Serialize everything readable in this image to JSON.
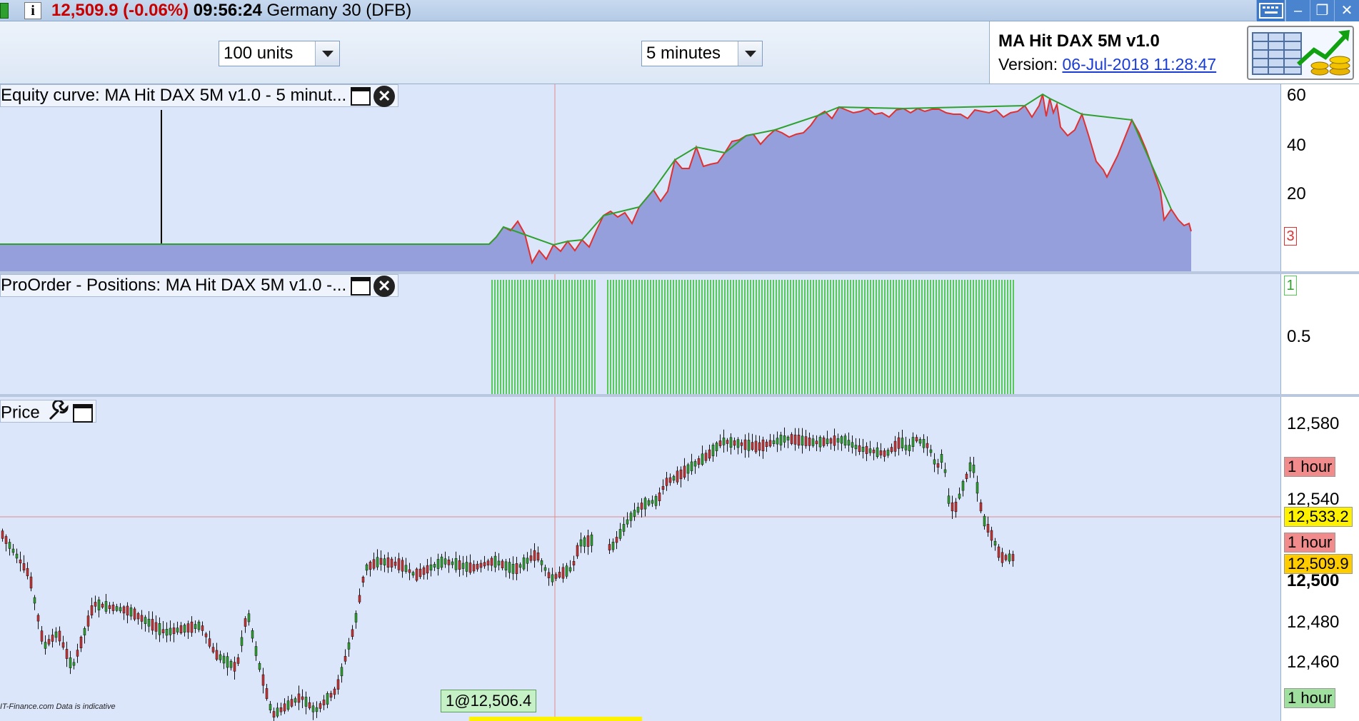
{
  "titlebar": {
    "price": "12,509.9 (-0.06%)",
    "time": "09:56:24",
    "instrument": "Germany 30 (DFB)"
  },
  "toolbar": {
    "units": "100 units",
    "timeframe": "5 minutes"
  },
  "info": {
    "system_name": "MA Hit DAX 5M v1.0",
    "version_label": "Version:",
    "version_date": "06-Jul-2018 11:28:47"
  },
  "equity_panel": {
    "label": "Equity curve: MA Hit DAX 5M v1.0 - 5 minut...",
    "ticks": [
      "60",
      "40",
      "20"
    ],
    "marker": "3"
  },
  "positions_panel": {
    "label": "ProOrder - Positions: MA Hit DAX 5M v1.0 -...",
    "ticks": [
      "0.5"
    ],
    "marker": "1"
  },
  "price_panel": {
    "label": "Price",
    "ticks": [
      "12,580",
      "12,540",
      "12,500",
      "12,480",
      "12,460"
    ],
    "tag_hour_1": "1 hour",
    "tag_crosshair": "12,533.2",
    "tag_hour_2": "1 hour",
    "tag_last": "12,509.9",
    "tag_hour_3": "1 hour",
    "order_label": "1@12,506.4",
    "source": "IT-Finance.com",
    "indicative": "Data is indicative"
  },
  "colors": {
    "equity_fill": "#949fdb",
    "position_bar": "#55cc55",
    "candle_up": "#2ea02e",
    "candle_down": "#c83232",
    "tag_red": "#f28c8c",
    "tag_yellow": "#fff200",
    "tag_gold": "#ffcc00",
    "tag_green": "#9fe09f"
  },
  "icons": [
    "keyboard-icon",
    "minimize-icon",
    "restore-icon",
    "close-icon",
    "ruler-chart-icon",
    "wrench-icon"
  ]
}
